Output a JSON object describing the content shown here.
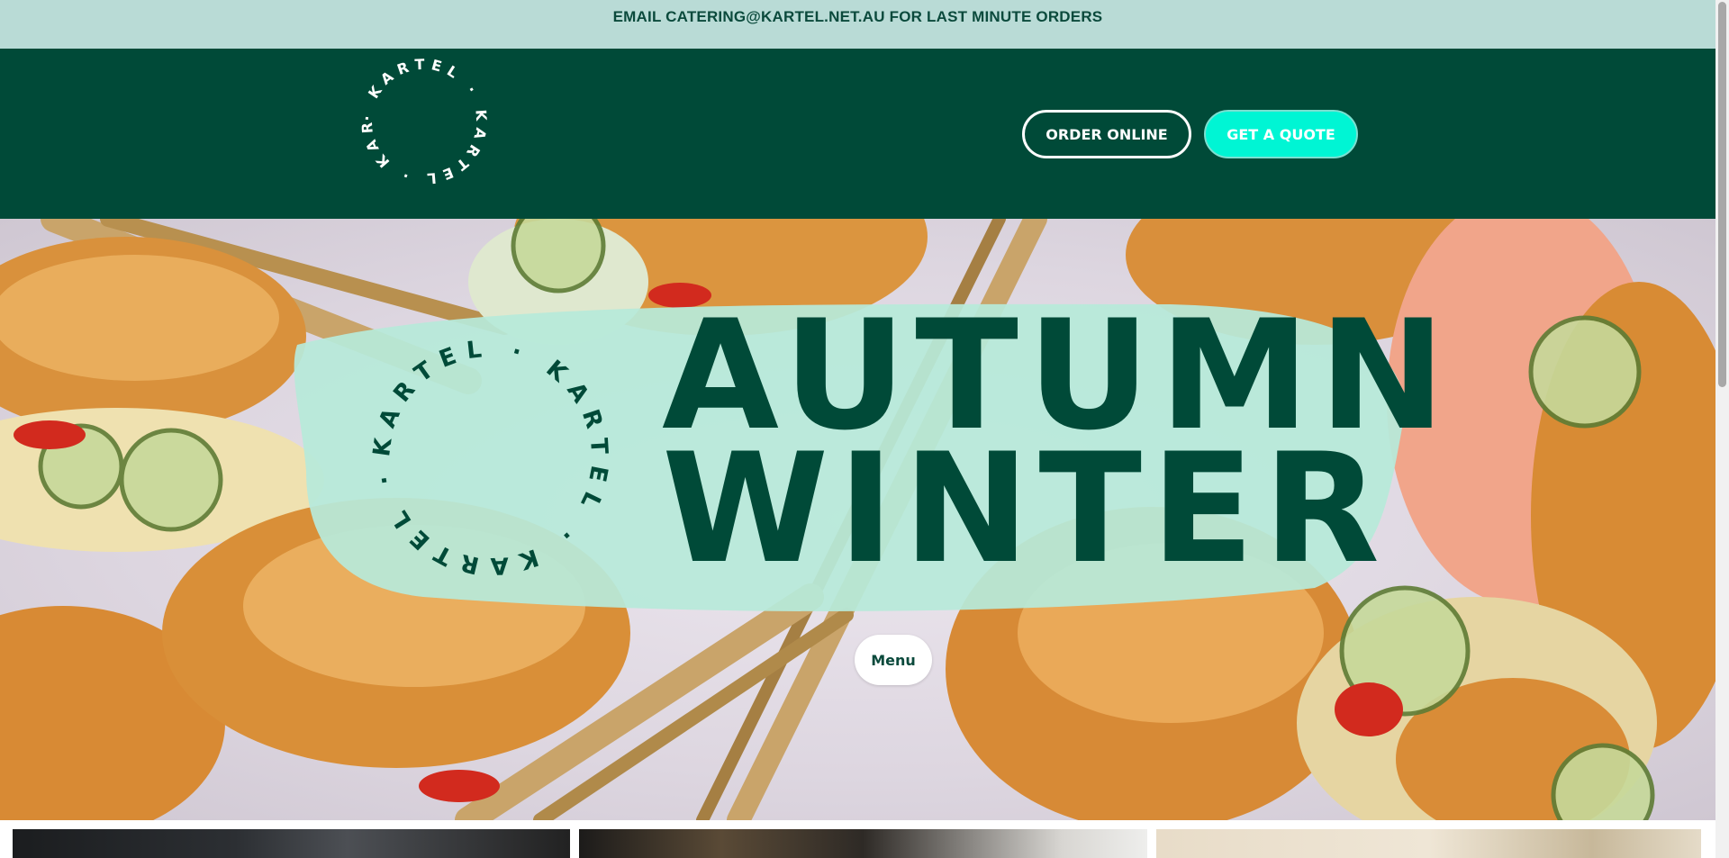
{
  "announcement": {
    "text": "EMAIL CATERING@KARTEL.NET.AU FOR LAST MINUTE ORDERS"
  },
  "header": {
    "logo_text": "· KARTEL · KARTEL · KARTEL",
    "order_online": "ORDER ONLINE",
    "get_quote": "GET A QUOTE"
  },
  "hero": {
    "line1": "AUTUMN",
    "line2": "WINTER",
    "badge_text": "KARTEL · KARTEL · KARTEL ·",
    "menu_button": "Menu"
  },
  "colors": {
    "announcement_bg": "#b9dbd6",
    "header_bg": "#004a38",
    "accent": "#00f5d4",
    "title_color": "#004a38"
  },
  "icons": {
    "logo": "kartel-circle-logo"
  }
}
